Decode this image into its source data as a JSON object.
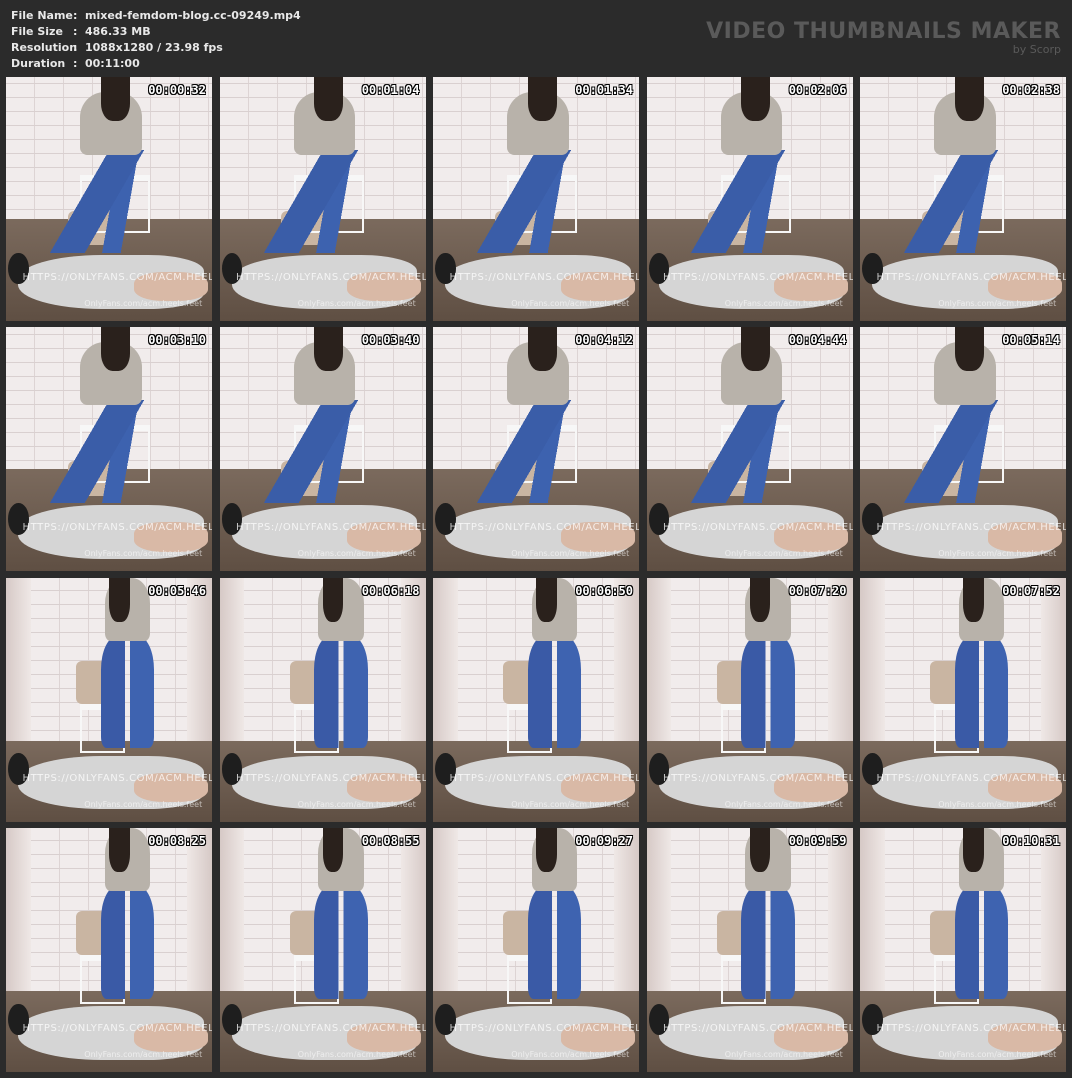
{
  "file_info": [
    {
      "label": "File Name",
      "value": "mixed-femdom-blog.cc-09249.mp4"
    },
    {
      "label": "File Size",
      "value": "486.33 MB"
    },
    {
      "label": "Resolution",
      "value": "1088x1280 / 23.98 fps"
    },
    {
      "label": "Duration",
      "value": "00:11:00"
    }
  ],
  "separator": ":",
  "brand": {
    "title": "VIDEO THUMBNAILS MAKER",
    "subtitle": "by Scorp"
  },
  "watermark": {
    "main": "HTTPS://ONLYFANS.COM/ACM.HEELS.FEET",
    "secondary": "OnlyFans.com/acm.heels.feet"
  },
  "thumbnails": [
    {
      "time": "00:00:32",
      "scene": "seated"
    },
    {
      "time": "00:01:04",
      "scene": "seated"
    },
    {
      "time": "00:01:34",
      "scene": "seated"
    },
    {
      "time": "00:02:06",
      "scene": "seated"
    },
    {
      "time": "00:02:38",
      "scene": "seated"
    },
    {
      "time": "00:03:10",
      "scene": "seated"
    },
    {
      "time": "00:03:40",
      "scene": "seated"
    },
    {
      "time": "00:04:12",
      "scene": "seated"
    },
    {
      "time": "00:04:44",
      "scene": "seated"
    },
    {
      "time": "00:05:14",
      "scene": "seated"
    },
    {
      "time": "00:05:46",
      "scene": "standing"
    },
    {
      "time": "00:06:18",
      "scene": "standing"
    },
    {
      "time": "00:06:50",
      "scene": "standing"
    },
    {
      "time": "00:07:20",
      "scene": "standing"
    },
    {
      "time": "00:07:52",
      "scene": "standing"
    },
    {
      "time": "00:08:25",
      "scene": "standing"
    },
    {
      "time": "00:08:55",
      "scene": "standing"
    },
    {
      "time": "00:09:27",
      "scene": "standing"
    },
    {
      "time": "00:09:59",
      "scene": "standing"
    },
    {
      "time": "00:10:31",
      "scene": "standing"
    }
  ]
}
